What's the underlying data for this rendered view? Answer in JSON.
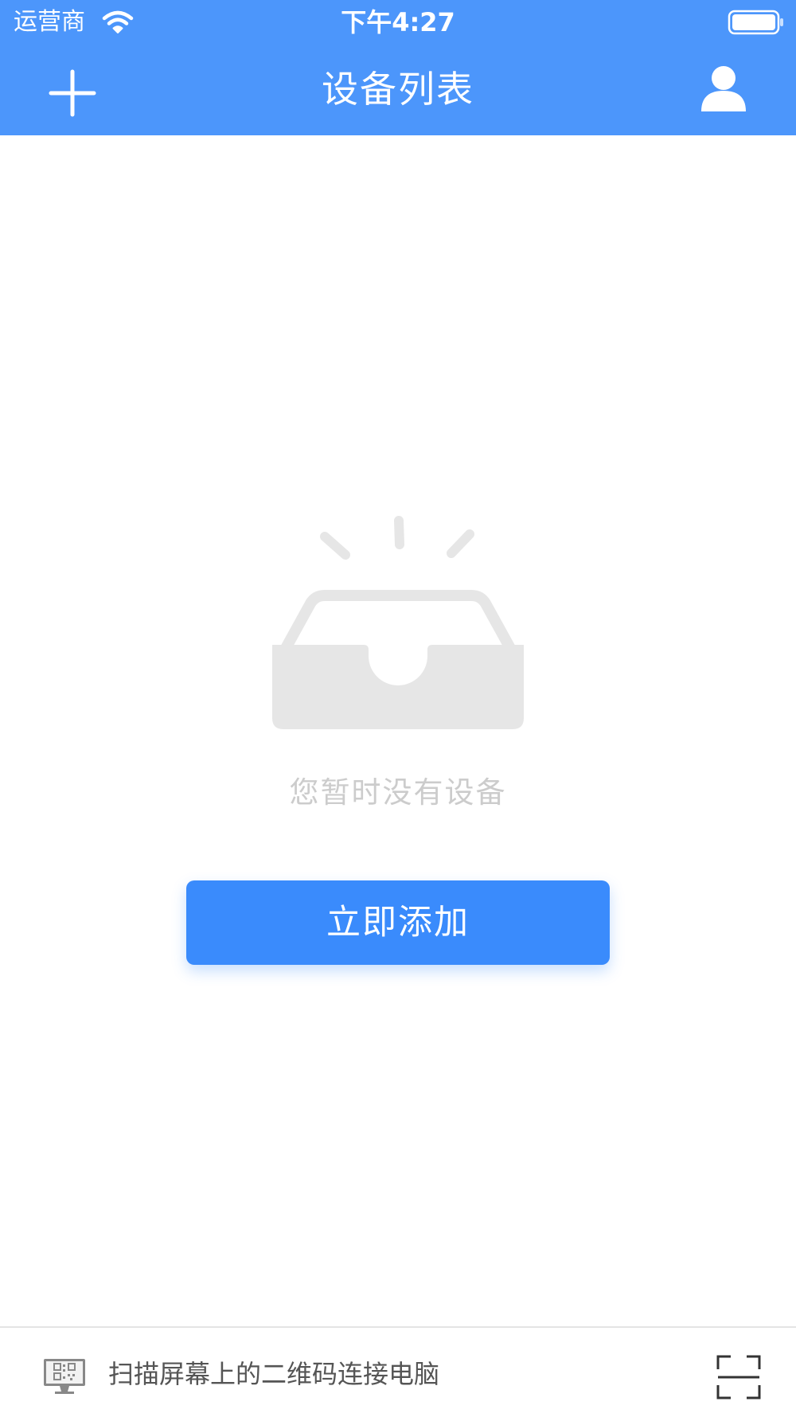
{
  "status_bar": {
    "carrier": "运营商",
    "time": "下午4:27",
    "icons": [
      "wifi-icon",
      "battery-icon"
    ]
  },
  "nav_bar": {
    "title": "设备列表",
    "left_icon": "plus-icon",
    "right_icon": "user-icon"
  },
  "empty_state": {
    "icon": "empty-inbox-icon",
    "message": "您暂时没有设备",
    "button_label": "立即添加"
  },
  "bottom_bar": {
    "left_icon": "monitor-qr-icon",
    "label": "扫描屏幕上的二维码连接电脑",
    "right_icon": "scan-icon"
  },
  "colors": {
    "header": "#4c96fb",
    "button": "#3a8bfc",
    "empty_icon": "#e6e6e6",
    "empty_text": "#cccccc",
    "bottom_text": "#555555"
  }
}
